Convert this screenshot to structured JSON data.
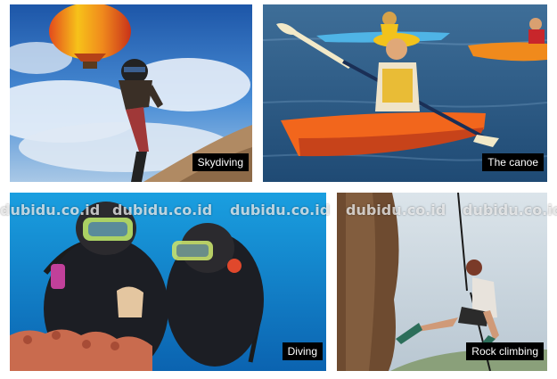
{
  "tiles": [
    {
      "caption": "Skydiving"
    },
    {
      "caption": "The canoe"
    },
    {
      "caption": "Diving"
    },
    {
      "caption": "Rock climbing"
    }
  ],
  "watermark": "dubidu.co.id"
}
